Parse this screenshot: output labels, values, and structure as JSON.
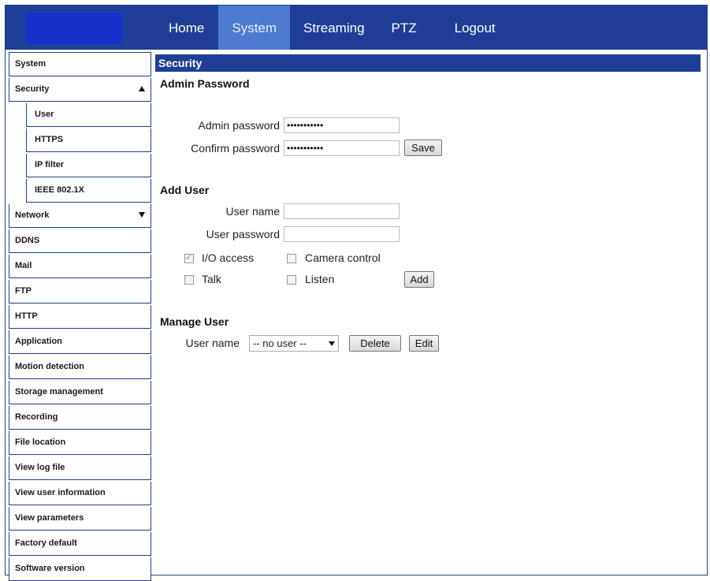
{
  "nav": {
    "home": "Home",
    "system": "System",
    "streaming": "Streaming",
    "ptz": "PTZ",
    "logout": "Logout"
  },
  "sidebar": {
    "system": "System",
    "security": "Security",
    "security_sub": [
      "User",
      "HTTPS",
      "IP filter",
      "IEEE 802.1X"
    ],
    "network": "Network",
    "items": [
      "DDNS",
      "Mail",
      "FTP",
      "HTTP",
      "Application",
      "Motion detection",
      "Storage management",
      "Recording",
      "File location",
      "View log file",
      "View user information",
      "View parameters",
      "Factory default",
      "Software version"
    ]
  },
  "main": {
    "section_title": "Security",
    "admin_password": {
      "heading": "Admin Password",
      "admin_label": "Admin password",
      "admin_value": "•••••••••••",
      "confirm_label": "Confirm password",
      "confirm_value": "•••••••••••",
      "save": "Save"
    },
    "add_user": {
      "heading": "Add User",
      "username_label": "User name",
      "password_label": "User password",
      "io_access": "I/O access",
      "camera_control": "Camera control",
      "talk": "Talk",
      "listen": "Listen",
      "add": "Add"
    },
    "manage_user": {
      "heading": "Manage User",
      "username_label": "User name",
      "select_value": "-- no user --",
      "delete": "Delete",
      "edit": "Edit"
    }
  }
}
